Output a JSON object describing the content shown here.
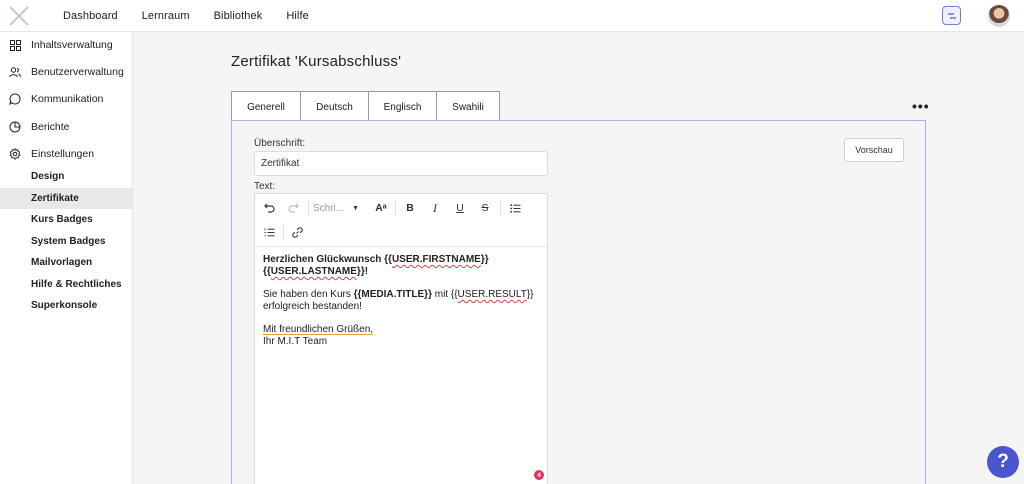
{
  "topnav": {
    "items": [
      "Dashboard",
      "Lernraum",
      "Bibliothek",
      "Hilfe"
    ]
  },
  "sidebar": {
    "items": [
      {
        "label": "Inhaltsverwaltung",
        "icon": "grid-icon"
      },
      {
        "label": "Benutzerverwaltung",
        "icon": "users-icon"
      },
      {
        "label": "Kommunikation",
        "icon": "chat-bubble-icon"
      },
      {
        "label": "Berichte",
        "icon": "pie-chart-icon"
      },
      {
        "label": "Einstellungen",
        "icon": "gear-icon"
      }
    ],
    "subitems": [
      "Design",
      "Zertifikate",
      "Kurs Badges",
      "System Badges",
      "Mailvorlagen",
      "Hilfe & Rechtliches",
      "Superkonsole"
    ],
    "active_subitem": "Zertifikate"
  },
  "page": {
    "title": "Zertifikat 'Kursabschluss'",
    "tabs": [
      "Generell",
      "Deutsch",
      "Englisch",
      "Swahili"
    ],
    "more_label": "•••",
    "heading_label": "Überschrift:",
    "heading_value": "Zertifikat",
    "text_label": "Text:",
    "preview_label": "Vorschau"
  },
  "editor": {
    "font_placeholder": "Schri...",
    "bold_glyph": "B",
    "italic_glyph": "I",
    "underline_glyph": "U",
    "strike_glyph": "S",
    "fontsize_glyph": "Aᵃ",
    "line1_a": "Herzlichen Glückwunsch {{",
    "line1_b": "USER.FIRSTNAME",
    "line1_c": "}}",
    "line2_a": "{{",
    "line2_b": "USER.LASTNAME",
    "line2_c": "}}!",
    "p2_a": "Sie haben den Kurs ",
    "p2_b": "{{MEDIA.TITLE}}",
    "p2_c": " mit {{",
    "p2_d": "USER.RESULT",
    "p2_e": "}} erfolgreich bestanden!",
    "p3_a": "Mit freundlichen Grüßen,",
    "p3_b": "Ihr M.I.T Team",
    "error_count": "4"
  },
  "help": {
    "label": "?"
  },
  "colors": {
    "accent": "#4a55d0",
    "panel_border": "#a9b1e6",
    "error": "#e0335b"
  }
}
